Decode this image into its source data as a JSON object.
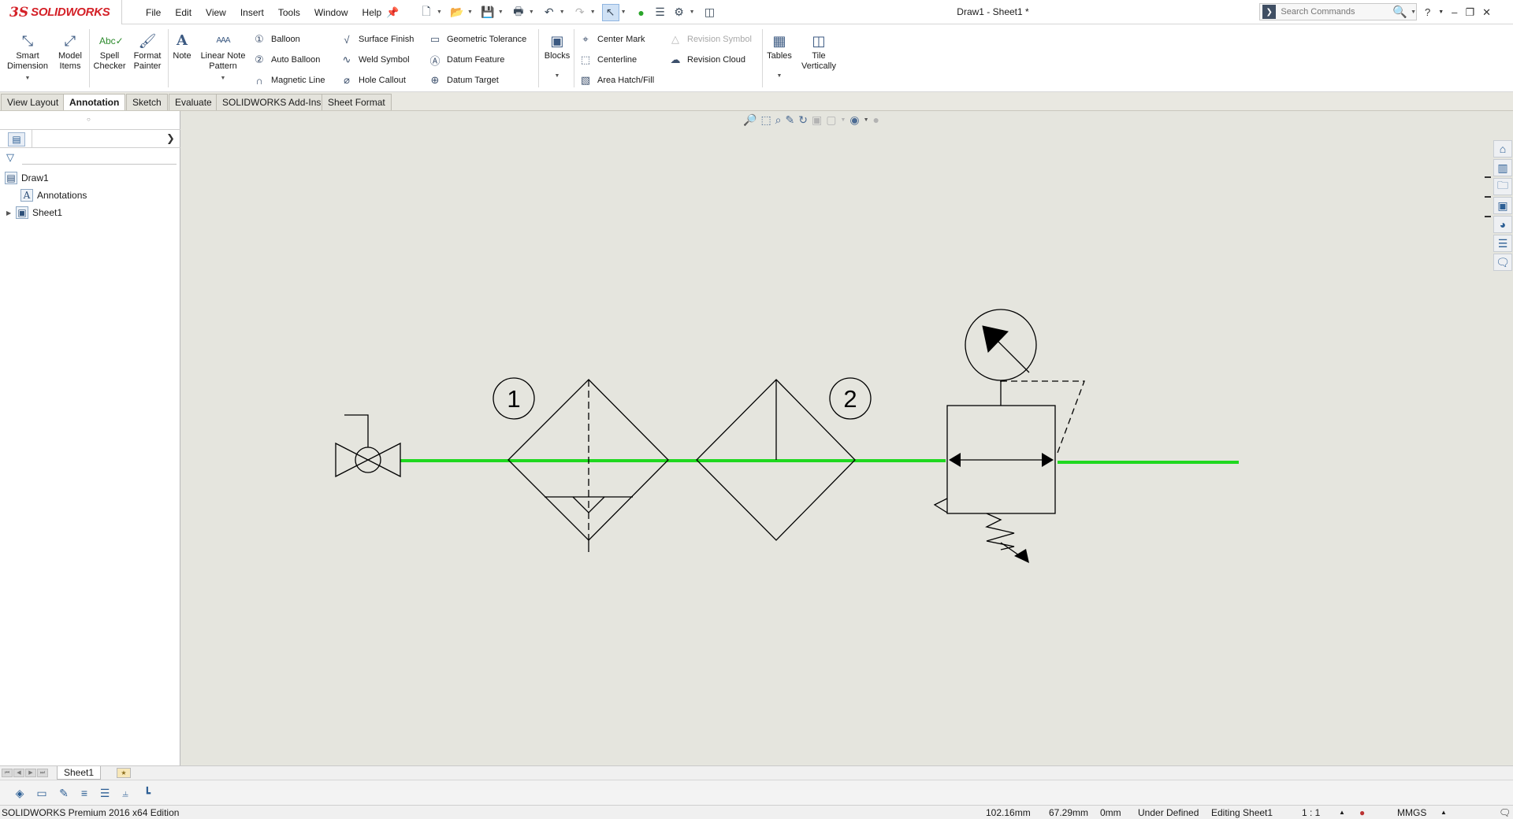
{
  "app": {
    "brand_prefix": "3S",
    "brand_name": "SOLIDWORKS",
    "document_title": "Draw1 - Sheet1 *",
    "accent_color": "#d42027"
  },
  "menu": [
    "File",
    "Edit",
    "View",
    "Insert",
    "Tools",
    "Window",
    "Help"
  ],
  "quick_access_icons": [
    "new-document-icon",
    "open-icon",
    "save-icon",
    "print-icon",
    "undo-icon",
    "redo-icon",
    "select-icon",
    "rebuild-icon",
    "file-properties-icon",
    "options-icon",
    "layout-icon"
  ],
  "search": {
    "placeholder": "Search Commands"
  },
  "window_controls": [
    "help-icon",
    "minimize-icon",
    "restore-icon",
    "close-icon"
  ],
  "ribbon": {
    "smart_dimension": "Smart Dimension",
    "model_items": "Model Items",
    "spell_checker": "Spell Checker",
    "format_painter": "Format Painter",
    "note": "Note",
    "linear_note_pattern": "Linear Note Pattern",
    "balloon": "Balloon",
    "auto_balloon": "Auto Balloon",
    "magnetic_line": "Magnetic Line",
    "surface_finish": "Surface Finish",
    "weld_symbol": "Weld Symbol",
    "hole_callout": "Hole Callout",
    "geometric_tolerance": "Geometric Tolerance",
    "datum_feature": "Datum Feature",
    "datum_target": "Datum Target",
    "blocks": "Blocks",
    "center_mark": "Center Mark",
    "centerline": "Centerline",
    "area_hatch_fill": "Area Hatch/Fill",
    "revision_symbol": "Revision Symbol",
    "revision_cloud": "Revision Cloud",
    "tables": "Tables",
    "tile_vertically": "Tile Vertically"
  },
  "tabs": [
    "View Layout",
    "Annotation",
    "Sketch",
    "Evaluate",
    "SOLIDWORKS Add-Ins",
    "Sheet Format"
  ],
  "active_tab": "Annotation",
  "feature_tree": {
    "root": "Draw1",
    "items": [
      {
        "label": "Annotations",
        "expandable": false
      },
      {
        "label": "Sheet1",
        "expandable": true
      }
    ]
  },
  "drawing": {
    "balloon_1": "1",
    "balloon_2": "2",
    "pipe_color": "#1fd81f",
    "line_color": "#000000",
    "background": "#e5e5de"
  },
  "sheet_tabs": [
    "Sheet1"
  ],
  "status_bar": {
    "edition": "SOLIDWORKS Premium 2016 x64 Edition",
    "x": "102.16mm",
    "y": "67.29mm",
    "z": "0mm",
    "state": "Under Defined",
    "editing": "Editing Sheet1",
    "scale": "1 : 1",
    "units": "MMGS"
  }
}
